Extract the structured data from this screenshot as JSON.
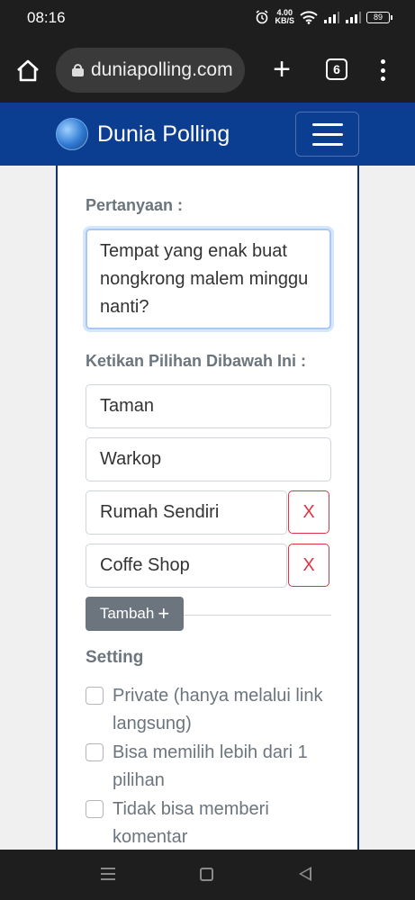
{
  "status": {
    "time": "08:16",
    "net_speed_top": "4.00",
    "net_speed_unit": "KB/S",
    "battery": "89"
  },
  "browser": {
    "url": "duniapolling.com",
    "tab_count": "6"
  },
  "navbar": {
    "brand": "Dunia Polling"
  },
  "form": {
    "question_label": "Pertanyaan :",
    "question_value": "Tempat yang enak buat nongkrong malem minggu nanti?",
    "options_label": "Ketikan Pilihan Dibawah Ini :",
    "options": [
      "Taman",
      "Warkop",
      "Rumah Sendiri",
      "Coffe Shop"
    ],
    "remove_label": "X",
    "add_button": "Tambah",
    "add_icon": "+",
    "setting_title": "Setting",
    "settings": [
      "Private (hanya melalui link langsung)",
      "Bisa memilih lebih dari 1 pilihan",
      "Tidak bisa memberi komentar"
    ]
  },
  "colors": {
    "navbar": "#0b3d91",
    "danger": "#dc3545",
    "secondary": "#6c757d"
  }
}
